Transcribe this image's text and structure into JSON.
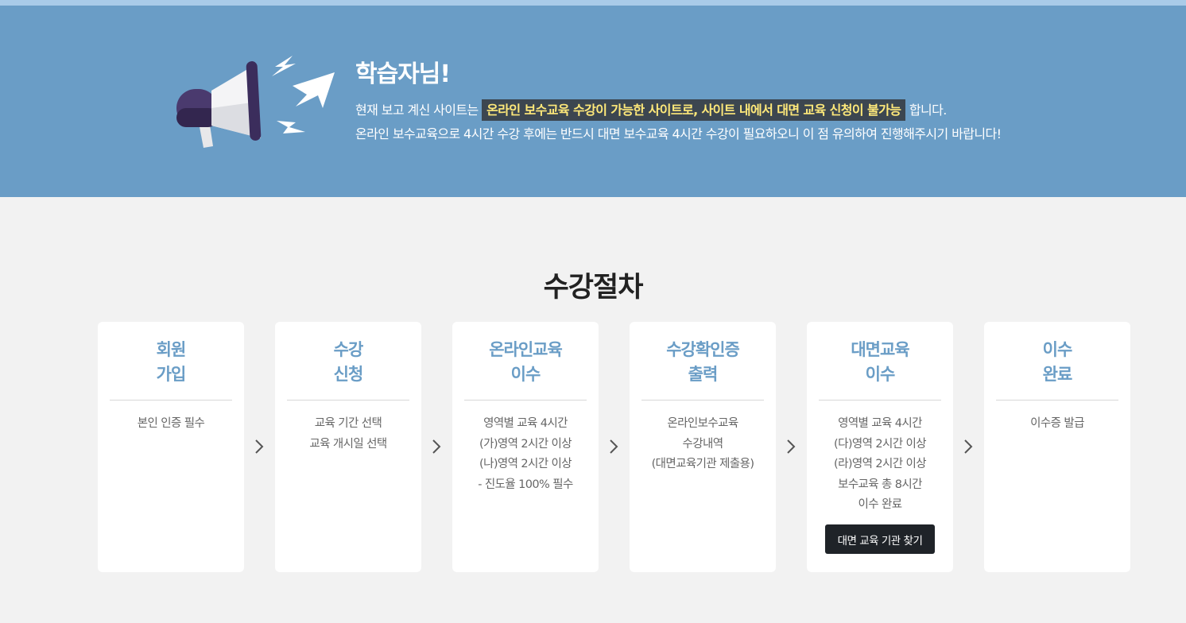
{
  "banner": {
    "title": "학습자님!",
    "line1_before": "현재 보고 계신 사이트는",
    "line1_highlight": "온라인 보수교육 수강이 가능한 사이트로, 사이트 내에서 대면 교육 신청이 불가능",
    "line1_after": "합니다.",
    "line2": "온라인 보수교육으로 4시간 수강 후에는 반드시 대면 보수교육 4시간 수강이 필요하오니 이 점 유의하여 진행해주시기 바랍니다!",
    "icon": "megaphone-icon"
  },
  "section": {
    "title": "수강절차"
  },
  "steps": [
    {
      "title": [
        "회원",
        "가입"
      ],
      "lines": [
        "본인 인증 필수"
      ]
    },
    {
      "title": [
        "수강",
        "신청"
      ],
      "lines": [
        "교육 기간 선택",
        "교육 개시일 선택"
      ]
    },
    {
      "title": [
        "온라인교육",
        "이수"
      ],
      "lines": [
        "영역별 교육 4시간",
        "(가)영역 2시간 이상",
        "(나)영역 2시간 이상",
        "- 진도율 100% 필수"
      ]
    },
    {
      "title": [
        "수강확인증",
        "출력"
      ],
      "lines": [
        "온라인보수교육",
        "수강내역",
        "(대면교육기관 제출용)"
      ]
    },
    {
      "title": [
        "대면교육",
        "이수"
      ],
      "lines": [
        "영역별 교육 4시간",
        "(다)영역 2시간 이상",
        "(라)영역 2시간 이상",
        "보수교육 총 8시간",
        "이수 완료"
      ],
      "button": "대면 교육 기관 찾기"
    },
    {
      "title": [
        "이수",
        "완료"
      ],
      "lines": [
        "이수증 발급"
      ]
    }
  ],
  "colors": {
    "banner": "#6a9dc6",
    "accent": "#6a9dc6",
    "highlight_bg": "#3c4650",
    "highlight_text": "#ffe97a",
    "button_bg": "#1f2328"
  },
  "arrow_icon": "chevron-right-icon"
}
